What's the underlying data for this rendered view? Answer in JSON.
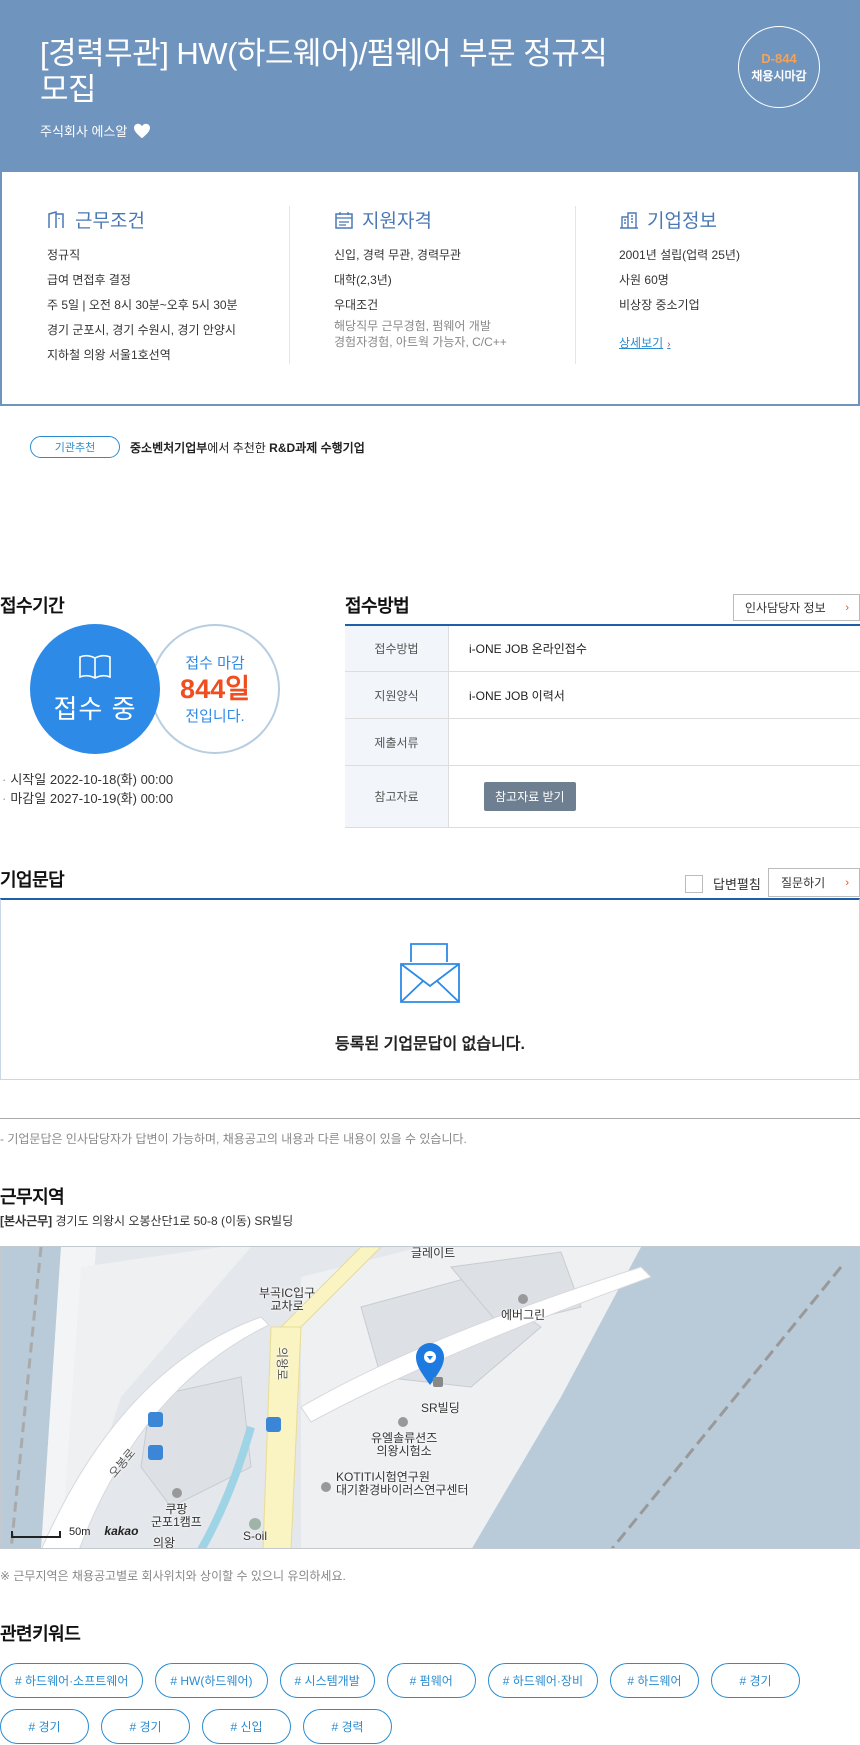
{
  "header": {
    "title": "[경력무관] HW(하드웨어)/펌웨어 부문 정규직 모집",
    "company": "주식회사 에스알",
    "dday": "D-844",
    "dday_label": "채용시마감"
  },
  "summary": {
    "conditions": {
      "title": "근무조건",
      "lines": [
        "정규직",
        "급여 면접후 결정",
        "주 5일 | 오전 8시 30분~오후 5시 30분",
        "경기 군포시, 경기 수원시, 경기 안양시",
        "지하철 의왕 서울1호선역"
      ]
    },
    "qualification": {
      "title": "지원자격",
      "lines": [
        "신입, 경력 무관, 경력무관",
        "대학(2,3년)",
        "우대조건"
      ],
      "sub": [
        "해당직무 근무경험, 펌웨어 개발",
        "경험자경험, 아트웍 가능자, C/C++"
      ]
    },
    "company_info": {
      "title": "기업정보",
      "lines": [
        "2001년 설립(업력 25년)",
        "사원 60명",
        "비상장 중소기업"
      ],
      "link": "상세보기"
    }
  },
  "recommend": {
    "badge": "기관추천",
    "org": "중소벤처기업부",
    "mid": "에서 추천한 ",
    "program": "R&D과제 수행기업"
  },
  "period": {
    "title": "접수기간",
    "status": "접수 중",
    "deadline_pre": "접수 마감",
    "deadline_days": "844일",
    "deadline_post": "전입니다.",
    "start": "시작일 2022-10-18(화) 00:00",
    "end": "마감일 2027-10-19(화) 00:00"
  },
  "apply": {
    "title": "접수방법",
    "hr_button": "인사담당자 정보",
    "rows": [
      {
        "key": "접수방법",
        "value": "i-ONE JOB 온라인접수"
      },
      {
        "key": "지원양식",
        "value": "i-ONE JOB 이력서"
      },
      {
        "key": "제출서류",
        "value": ""
      },
      {
        "key": "참고자료",
        "value": "참고자료 받기"
      }
    ]
  },
  "qna": {
    "title": "기업문답",
    "toggle_label": "답변펼침",
    "ask_button": "질문하기",
    "empty": "등록된 기업문답이 없습니다.",
    "note": "- 기업문답은 인사담당자가 답변이 가능하며, 채용공고의 내용과 다른 내용이 있을 수 있습니다."
  },
  "location": {
    "title": "근무지역",
    "tag": "[본사근무]",
    "address": "경기도 의왕시 오봉산단1로 50-8 (이동) SR빌딩",
    "map_labels": {
      "ic": "부곡IC입구\n교차로",
      "everg": "에버그린",
      "sr": "SR빌딩",
      "uel": "유엘솔류션즈\n의왕시험소",
      "kotiti": "KOTITI시험연구원\n대기환경바이러스연구센터",
      "coupang": "쿠팡\n군포1캠프",
      "soil": "S-oil",
      "road": "오봉로",
      "road2": "의왕로",
      "top": "글레이트",
      "uiwang": "의왕"
    },
    "scale": "50m",
    "provider": "kakao",
    "note": "※ 근무지역은 채용공고별로 회사위치와 상이할 수 있으니 유의하세요."
  },
  "keywords": {
    "title": "관련키워드",
    "items": [
      "# 하드웨어·소프트웨어",
      "# HW(하드웨어)",
      "# 시스템개발",
      "# 펌웨어",
      "# 하드웨어·장비",
      "# 하드웨어",
      "# 경기",
      "# 경기",
      "# 경기",
      "# 신입",
      "# 경력"
    ]
  },
  "colors": {
    "header_bg": "#6f94be",
    "accent_blue": "#2d8ae6",
    "deadline_orange": "#f04e1f",
    "table_border": "#1d5fa8"
  }
}
